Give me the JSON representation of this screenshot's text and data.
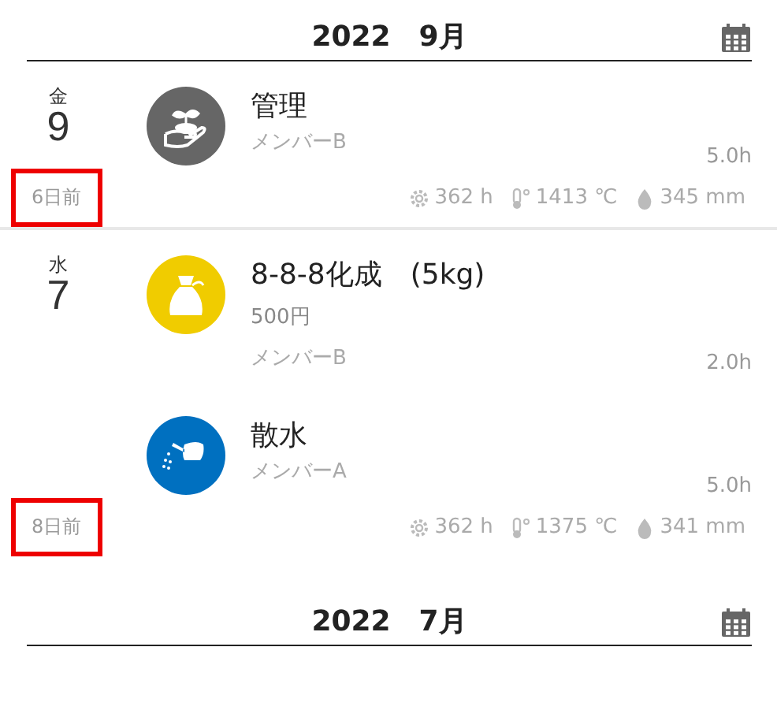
{
  "months": [
    {
      "title": "2022　9月",
      "days": [
        {
          "weekday": "金",
          "date": "9",
          "ago": {
            "text": "6日前",
            "highlighted": true
          },
          "entries": [
            {
              "kind": "sprout",
              "color": "#666666",
              "title": "管理",
              "member": "メンバーB",
              "hours": "5.0h"
            }
          ],
          "stats": {
            "heat_hours": "362 h",
            "temperature": "1413 ℃",
            "rain": "345 mm"
          }
        },
        {
          "weekday": "水",
          "date": "7",
          "ago": {
            "text": "8日前",
            "highlighted": true
          },
          "entries": [
            {
              "kind": "bag",
              "color": "#f0cc00",
              "title": "8-8-8化成　(5kg)",
              "price": "500円",
              "member": "メンバーB",
              "hours": "2.0h"
            },
            {
              "kind": "watering",
              "color": "#0070c0",
              "title": "散水",
              "member": "メンバーA",
              "hours": "5.0h"
            }
          ],
          "stats": {
            "heat_hours": "362 h",
            "temperature": "1375 ℃",
            "rain": "341 mm"
          }
        }
      ]
    },
    {
      "title": "2022　7月"
    }
  ]
}
